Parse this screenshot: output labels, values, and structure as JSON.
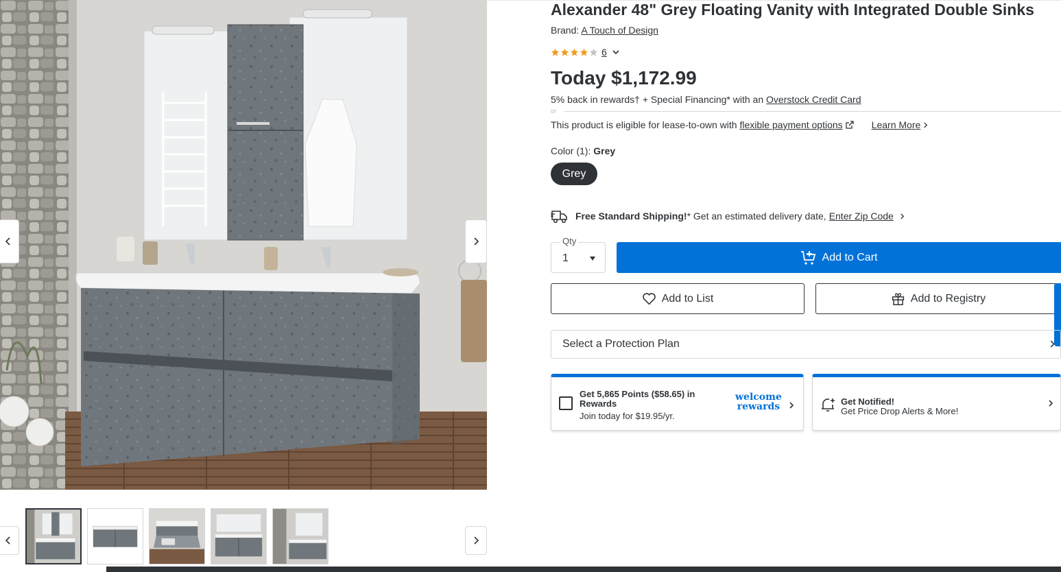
{
  "gallery": {
    "main_image_alt": "",
    "thumbnail_count": 5,
    "active_thumbnail": 1
  },
  "product": {
    "title": "Alexander 48\" Grey Floating Vanity with Integrated Double Sinks",
    "brand_prefix": "Brand:",
    "brand_name": "A Touch of Design",
    "rating_stars": 4,
    "review_count": "6",
    "price": "Today $1,172.99"
  },
  "rewards_line": {
    "text": "5% back in rewards† + Special Financing* with an",
    "link": "Overstock Credit Card"
  },
  "or_text": "or",
  "lease": {
    "text": "This product is eligible for lease-to-own with",
    "link": "flexible payment options",
    "learn_more": "Learn More"
  },
  "color": {
    "label": "Color (1):",
    "selected": "Grey",
    "swatch_label": "Grey"
  },
  "shipping": {
    "bold": "Free Standard Shipping!",
    "text": "* Get an estimated delivery date,",
    "link": "Enter Zip Code"
  },
  "qty": {
    "label": "Qty",
    "value": "1"
  },
  "buttons": {
    "add_to_cart": "Add to Cart",
    "add_to_list": "Add to List",
    "add_to_registry": "Add to Registry",
    "protection_plan": "Select a Protection Plan"
  },
  "cards": {
    "rewards_title": "Get 5,865 Points ($58.65) in Rewards",
    "rewards_sub": "Join today for $19.95/yr.",
    "rewards_logo_line1": "welcome",
    "rewards_logo_line2": "rewards",
    "notify_title": "Get Notified!",
    "notify_sub": "Get Price Drop Alerts & More!"
  },
  "colors": {
    "primary_blue": "#0272d8",
    "text_dark": "#2f3337",
    "star_orange": "#f29c1f"
  }
}
